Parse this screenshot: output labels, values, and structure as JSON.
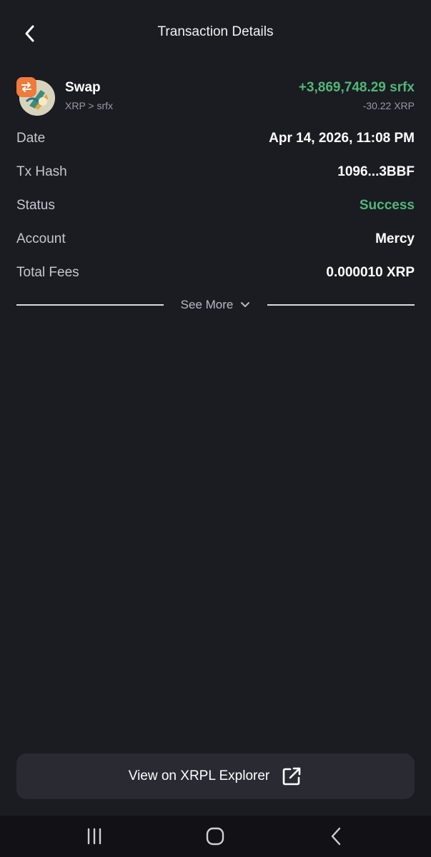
{
  "header": {
    "title": "Transaction Details"
  },
  "swap": {
    "title": "Swap",
    "pair": "XRP > srfx",
    "received_amount": "+3,869,748.29 srfx",
    "sent_amount": "-30.22 XRP"
  },
  "details": [
    {
      "label": "Date",
      "value": "Apr 14, 2026, 11:08 PM"
    },
    {
      "label": "Tx Hash",
      "value": "1096...3BBF"
    },
    {
      "label": "Status",
      "value": "Success"
    },
    {
      "label": "Account",
      "value": "Mercy"
    },
    {
      "label": "Total Fees",
      "value": "0.000010 XRP"
    }
  ],
  "see_more": {
    "label": "See More"
  },
  "explorer_button": {
    "label": "View on XRPL Explorer"
  },
  "colors": {
    "background": "#1b1b22",
    "success": "#4fb877",
    "button_bg": "#2a2a33",
    "swap_badge": "#f07a3a"
  },
  "icons": {
    "back": "chevron-left-icon",
    "swap_badge": "swap-arrows-icon",
    "see_more": "chevron-down-icon",
    "explorer": "external-link-icon",
    "nav_recent": "recent-apps-icon",
    "nav_home": "home-icon",
    "nav_back": "nav-back-icon"
  }
}
